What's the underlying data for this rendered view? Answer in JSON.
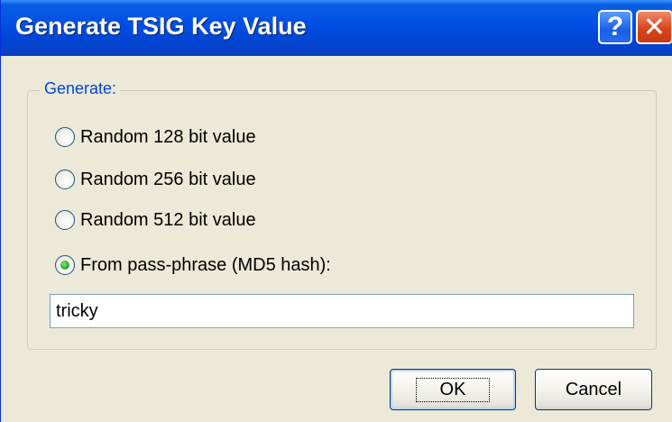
{
  "window": {
    "title": "Generate TSIG Key Value",
    "help_label": "?",
    "close_label": "✕"
  },
  "group": {
    "legend": "Generate:",
    "options": [
      {
        "label": "Random 128 bit value",
        "checked": false
      },
      {
        "label": "Random 256 bit value",
        "checked": false
      },
      {
        "label": "Random 512 bit value",
        "checked": false
      },
      {
        "label": "From pass-phrase (MD5 hash):",
        "checked": true
      }
    ],
    "passphrase_value": "tricky"
  },
  "buttons": {
    "ok": "OK",
    "cancel": "Cancel"
  }
}
